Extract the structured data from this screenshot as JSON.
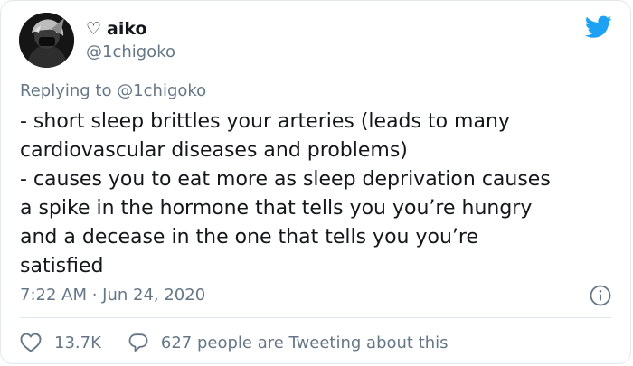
{
  "author": {
    "display_prefix": "♡",
    "display_name": "aiko",
    "handle": "@1chigoko"
  },
  "reply_context": "Replying to @1chigoko",
  "tweet_lines": [
    "- short sleep brittles your arteries (leads to many",
    "cardiovascular diseases and problems)",
    "- causes you to eat more as sleep deprivation causes",
    "a spike in the hormone that tells you you’re hungry",
    "and a decease in the one that tells you you’re",
    "satisfied"
  ],
  "timestamp": "7:22 AM · Jun 24, 2020",
  "actions": {
    "like_count": "13.7K",
    "reply_label": "627 people are Tweeting about this"
  },
  "icons": {
    "brand": "twitter-bird-icon",
    "info": "info-icon",
    "like": "heart-icon",
    "reply": "comment-bubble-icon"
  },
  "colors": {
    "brand_blue": "#1da1f2",
    "text_primary": "#14171a",
    "text_secondary": "#657786",
    "divider": "#e1e8ed"
  }
}
